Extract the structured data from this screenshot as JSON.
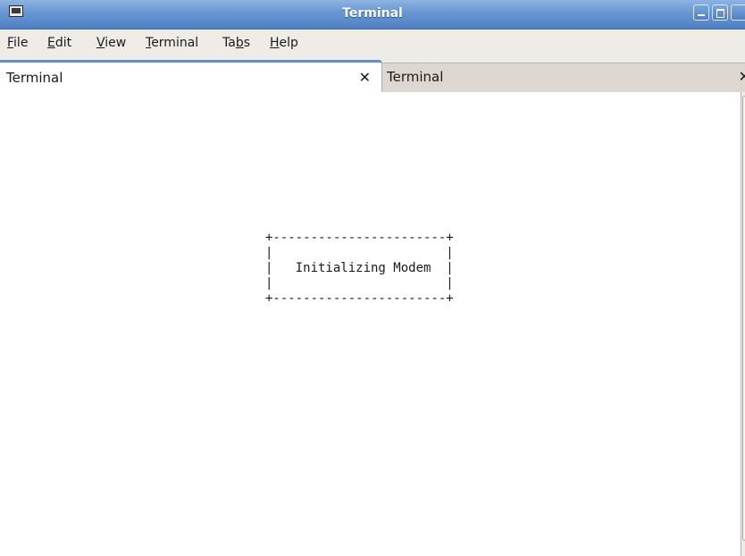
{
  "window": {
    "title": "Terminal",
    "icon": "terminal-icon"
  },
  "menubar": {
    "items": [
      {
        "label": "File",
        "mnemonic": "F",
        "rest": "ile"
      },
      {
        "label": "Edit",
        "mnemonic": "E",
        "rest": "dit"
      },
      {
        "label": "View",
        "mnemonic": "V",
        "rest": "iew"
      },
      {
        "label": "Terminal",
        "mnemonic": "T",
        "rest": "erminal"
      },
      {
        "label": "Tabs",
        "pre": "Ta",
        "mnemonic": "b",
        "rest": "s"
      },
      {
        "label": "Help",
        "mnemonic": "H",
        "rest": "elp"
      }
    ]
  },
  "tabs": [
    {
      "label": "Terminal",
      "active": true
    },
    {
      "label": "Terminal",
      "active": false
    }
  ],
  "terminal": {
    "screen_lines": [
      "+-----------------------+",
      "|                       |",
      "|   Initializing Modem  |",
      "|                       |",
      "+-----------------------+"
    ]
  }
}
